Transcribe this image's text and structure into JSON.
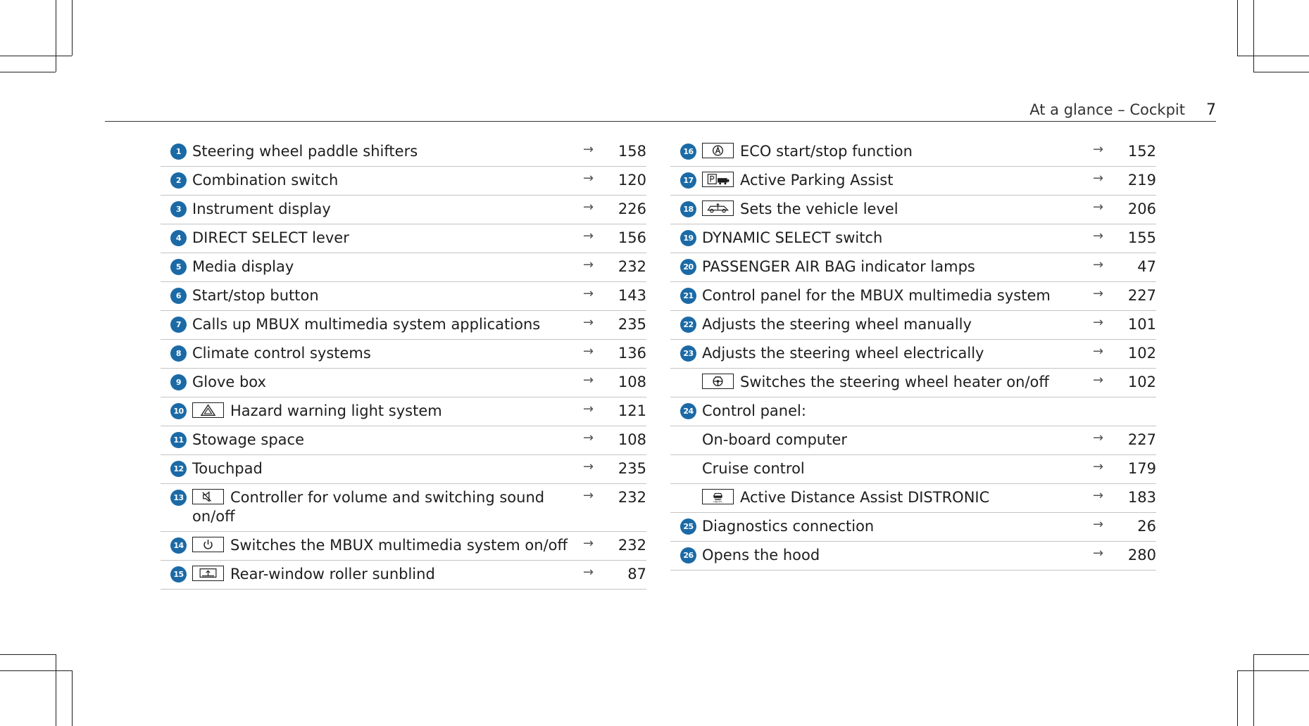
{
  "header": {
    "section": "At a glance – Cockpit",
    "page_number": "7"
  },
  "left_items": [
    {
      "num": "1",
      "label": "Steering wheel paddle shifters",
      "arrow": "→",
      "page": "158"
    },
    {
      "num": "2",
      "label": "Combination switch",
      "arrow": "→",
      "page": "120"
    },
    {
      "num": "3",
      "label": "Instrument display",
      "arrow": "→",
      "page": "226"
    },
    {
      "num": "4",
      "label": "DIRECT SELECT lever",
      "arrow": "→",
      "page": "156"
    },
    {
      "num": "5",
      "label": "Media display",
      "arrow": "→",
      "page": "232"
    },
    {
      "num": "6",
      "label": "Start/stop button",
      "arrow": "→",
      "page": "143"
    },
    {
      "num": "7",
      "label": "Calls up MBUX multimedia system applications",
      "arrow": "→",
      "page": "235"
    },
    {
      "num": "8",
      "label": "Climate control systems",
      "arrow": "→",
      "page": "136"
    },
    {
      "num": "9",
      "label": "Glove box",
      "arrow": "→",
      "page": "108"
    },
    {
      "num": "10",
      "icon": "hazard-warning-icon",
      "label": "Hazard warning light system",
      "arrow": "→",
      "page": "121"
    },
    {
      "num": "11",
      "label": "Stowage space",
      "arrow": "→",
      "page": "108"
    },
    {
      "num": "12",
      "label": "Touchpad",
      "arrow": "→",
      "page": "235"
    },
    {
      "num": "13",
      "icon": "speaker-mute-icon",
      "label": "Controller for volume and switching sound on/off",
      "arrow": "→",
      "page": "232"
    },
    {
      "num": "14",
      "icon": "power-icon",
      "label": "Switches the MBUX multimedia system on/off",
      "arrow": "→",
      "page": "232"
    },
    {
      "num": "15",
      "icon": "rear-sunblind-icon",
      "label": "Rear-window roller sunblind",
      "arrow": "→",
      "page": "87"
    }
  ],
  "right_items": [
    {
      "num": "16",
      "icon": "eco-start-stop-icon",
      "label": "ECO start/stop function",
      "arrow": "→",
      "page": "152"
    },
    {
      "num": "17",
      "icon": "parking-assist-icon",
      "label": "Active Parking Assist",
      "arrow": "→",
      "page": "219"
    },
    {
      "num": "18",
      "icon": "vehicle-level-icon",
      "label": "Sets the vehicle level",
      "arrow": "→",
      "page": "206"
    },
    {
      "num": "19",
      "label": "DYNAMIC SELECT switch",
      "arrow": "→",
      "page": "155"
    },
    {
      "num": "20",
      "label": "PASSENGER AIR BAG indicator lamps",
      "arrow": "→",
      "page": "47"
    },
    {
      "num": "21",
      "label": "Control panel for the MBUX multimedia system",
      "arrow": "→",
      "page": "227"
    },
    {
      "num": "22",
      "label": "Adjusts the steering wheel manually",
      "arrow": "→",
      "page": "101"
    },
    {
      "num": "23",
      "label": "Adjusts the steering wheel electrically",
      "arrow": "→",
      "page": "102"
    },
    {
      "num": "",
      "icon": "steering-wheel-heater-icon",
      "label": "Switches the steering wheel heater on/off",
      "arrow": "→",
      "page": "102"
    },
    {
      "num": "24",
      "label": "Control panel:",
      "arrow": "",
      "page": ""
    },
    {
      "num": "",
      "label": "On-board computer",
      "arrow": "→",
      "page": "227"
    },
    {
      "num": "",
      "label": "Cruise control",
      "arrow": "→",
      "page": "179"
    },
    {
      "num": "",
      "icon": "distronic-icon",
      "label": "Active Distance Assist DISTRONIC",
      "arrow": "→",
      "page": "183"
    },
    {
      "num": "25",
      "label": "Diagnostics connection",
      "arrow": "→",
      "page": "26"
    },
    {
      "num": "26",
      "label": "Opens the hood",
      "arrow": "→",
      "page": "280"
    }
  ]
}
